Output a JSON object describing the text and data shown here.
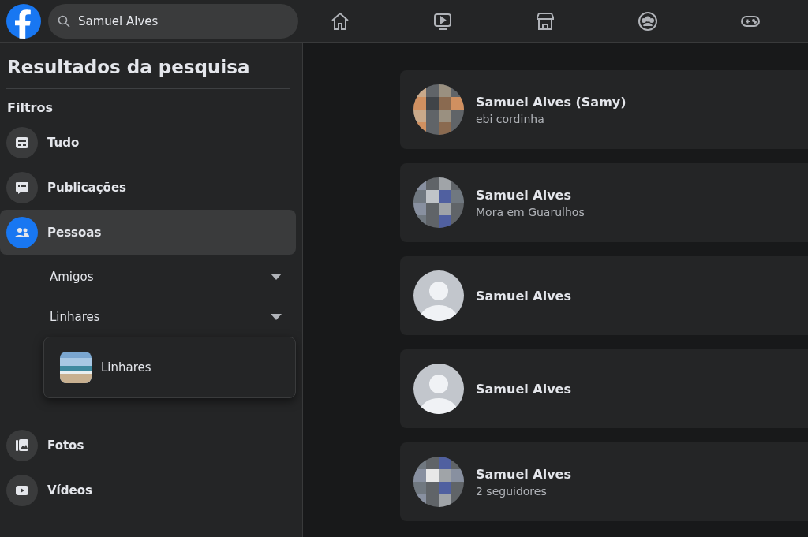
{
  "search": {
    "value": "Samuel Alves"
  },
  "nav": [
    {
      "kind": "home"
    },
    {
      "kind": "watch"
    },
    {
      "kind": "marketplace"
    },
    {
      "kind": "groups"
    },
    {
      "kind": "gaming"
    }
  ],
  "sidebar": {
    "title": "Resultados da pesquisa",
    "filters_heading": "Filtros",
    "items": [
      {
        "kind": "all",
        "label": "Tudo",
        "selected": false
      },
      {
        "kind": "posts",
        "label": "Publicações",
        "selected": false
      },
      {
        "kind": "people",
        "label": "Pessoas",
        "selected": true,
        "filters": [
          {
            "label": "Amigos"
          },
          {
            "label": "Linhares"
          }
        ]
      },
      {
        "kind": "photos",
        "label": "Fotos",
        "selected": false
      },
      {
        "kind": "videos",
        "label": "Vídeos",
        "selected": false
      }
    ],
    "dropdown": {
      "options": [
        {
          "kind": "picture",
          "label": "Linhares"
        }
      ]
    }
  },
  "results": [
    {
      "name": "Samuel Alves (Samy)",
      "detail": "ebi cordinha"
    },
    {
      "name": "Samuel Alves",
      "detail": "Mora em Guarulhos"
    },
    {
      "name": "Samuel Alves",
      "avatar": {
        "kind": "silhouette"
      }
    },
    {
      "name": "Samuel Alves",
      "avatar": {
        "kind": "silhouette"
      }
    },
    {
      "name": "Samuel Alves",
      "detail": "2 seguidores"
    }
  ]
}
